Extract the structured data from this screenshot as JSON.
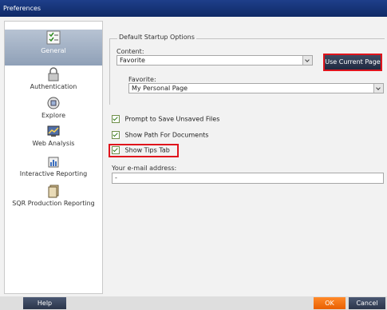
{
  "window": {
    "title": "Preferences"
  },
  "sidebar": {
    "items": [
      {
        "label": "General",
        "icon": "general-settings-icon"
      },
      {
        "label": "Authentication",
        "icon": "lock-icon"
      },
      {
        "label": "Explore",
        "icon": "explore-icon"
      },
      {
        "label": "Web Analysis",
        "icon": "web-analysis-icon"
      },
      {
        "label": "Interactive Reporting",
        "icon": "interactive-reporting-icon"
      },
      {
        "label": "SQR Production Reporting",
        "icon": "sqr-reporting-icon"
      }
    ]
  },
  "startup": {
    "group_title": "Default Startup Options",
    "content_label": "Content:",
    "content_value": "Favorite",
    "use_current_label": "Use Current Page",
    "favorite_label": "Favorite:",
    "favorite_value": "My Personal Page"
  },
  "options": {
    "prompt_save": "Prompt to Save Unsaved Files",
    "show_path": "Show Path For Documents",
    "show_tips": "Show Tips Tab"
  },
  "email": {
    "label": "Your e-mail address:",
    "value": "-"
  },
  "footer": {
    "help": "Help",
    "ok": "OK",
    "cancel": "Cancel"
  },
  "colors": {
    "title_bar": "#1a3a80",
    "highlight": "#e0141c",
    "ok_button": "#f07010",
    "active_item": "#9aaac0"
  }
}
